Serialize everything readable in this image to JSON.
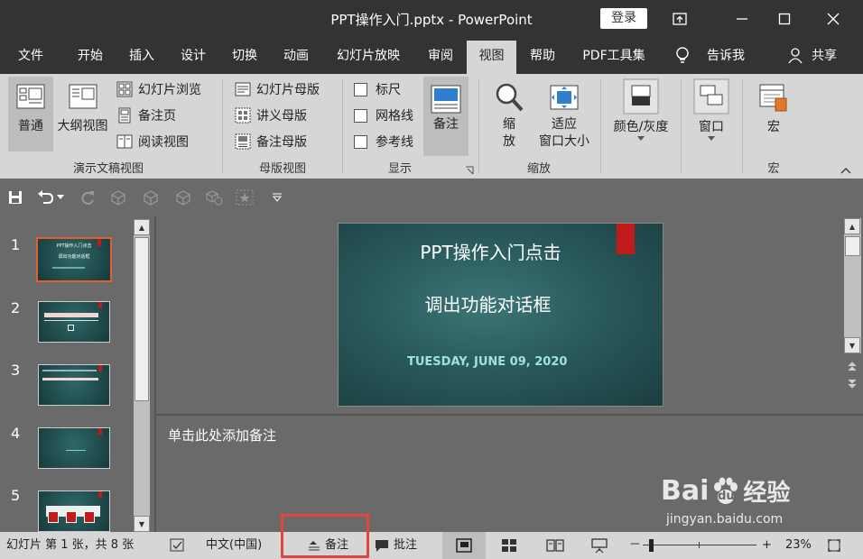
{
  "window": {
    "title": "PPT操作入门.pptx  -  PowerPoint",
    "login_label": "登录"
  },
  "menu": {
    "tabs": [
      "文件",
      "开始",
      "插入",
      "设计",
      "切换",
      "动画",
      "幻灯片放映",
      "审阅",
      "视图",
      "帮助",
      "PDF工具集"
    ],
    "active_tab": "视图",
    "tell_me": "告诉我",
    "share": "共享"
  },
  "ribbon": {
    "presentation_views": {
      "label": "演示文稿视图",
      "normal": "普通",
      "outline": "大纲视图",
      "slide_sorter": "幻灯片浏览",
      "notes_page": "备注页",
      "reading_view": "阅读视图"
    },
    "master_views": {
      "label": "母版视图",
      "slide_master": "幻灯片母版",
      "handout_master": "讲义母版",
      "notes_master": "备注母版"
    },
    "show": {
      "label": "显示",
      "ruler": "标尺",
      "gridlines": "网格线",
      "guides": "参考线",
      "notes": "备注"
    },
    "zoom": {
      "label": "缩放",
      "zoom_line1": "缩",
      "zoom_line2": "放",
      "fit_line1": "适应",
      "fit_line2": "窗口大小"
    },
    "color": {
      "label": "颜色/灰度"
    },
    "window": {
      "label": "窗口"
    },
    "macros": {
      "label": "宏",
      "button": "宏"
    }
  },
  "thumbnails": {
    "numbers": [
      "1",
      "2",
      "3",
      "4",
      "5"
    ],
    "slide1_title": "PPT操作入门点击",
    "slide1_sub": "调出功能对话框"
  },
  "slide": {
    "title_line1": "PPT操作入门点击",
    "title_line2": "调出功能对话框",
    "date": "TUESDAY, JUNE 09, 2020",
    "accent": "#c01a1a"
  },
  "notes": {
    "placeholder": "单击此处添加备注"
  },
  "status": {
    "slide_info": "幻灯片 第 1 张，共 8 张",
    "language": "中文(中国)",
    "notes_btn": "备注",
    "comments_btn": "批注",
    "zoom_minus": "－",
    "zoom_plus": "+",
    "zoom_value": "23%",
    "zoom_level": 0.23
  },
  "watermark": {
    "brand_a": "Bai",
    "brand_b": "du",
    "brand_c": "经验",
    "url": "jingyan.baidu.com"
  }
}
